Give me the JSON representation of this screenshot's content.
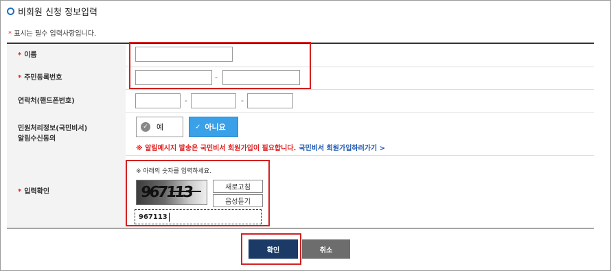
{
  "page": {
    "title": "비회원 신청 정보입력",
    "required_note_star": "*",
    "required_note": "표시는 필수 입력사항입니다."
  },
  "fields": {
    "name_label": "이름",
    "rrn_label": "주민등록번호",
    "rrn_dash": "-",
    "phone_label": "연락처(핸드폰번호)",
    "phone_dash1": "-",
    "phone_dash2": "-",
    "notify_label_line1": "민원처리정보(국민비서)",
    "notify_label_line2": "알림수신동의",
    "notify_yes": "예",
    "notify_no": "아니요",
    "notify_warning": "※ 알림메시지 발송은 국민비서 회원가입이 필요합니다.",
    "notify_link": "국민비서 회원가입하러가기 >",
    "captcha_label": "입력확인",
    "required_star": "*"
  },
  "captcha": {
    "instruction": "※ 아래의 숫자를 입력하세요.",
    "image_text": "967113",
    "refresh_label": "새로고침",
    "audio_label": "음성듣기",
    "input_value": "967113"
  },
  "buttons": {
    "confirm_label": "확인",
    "cancel_label": "취소"
  },
  "colors": {
    "required_red": "#e02020",
    "highlight_red": "#d32020",
    "toggle_active_blue": "#3aa0e8",
    "confirm_navy": "#1b3b66",
    "cancel_gray": "#6d6d6d",
    "link_blue": "#1a55b0"
  }
}
